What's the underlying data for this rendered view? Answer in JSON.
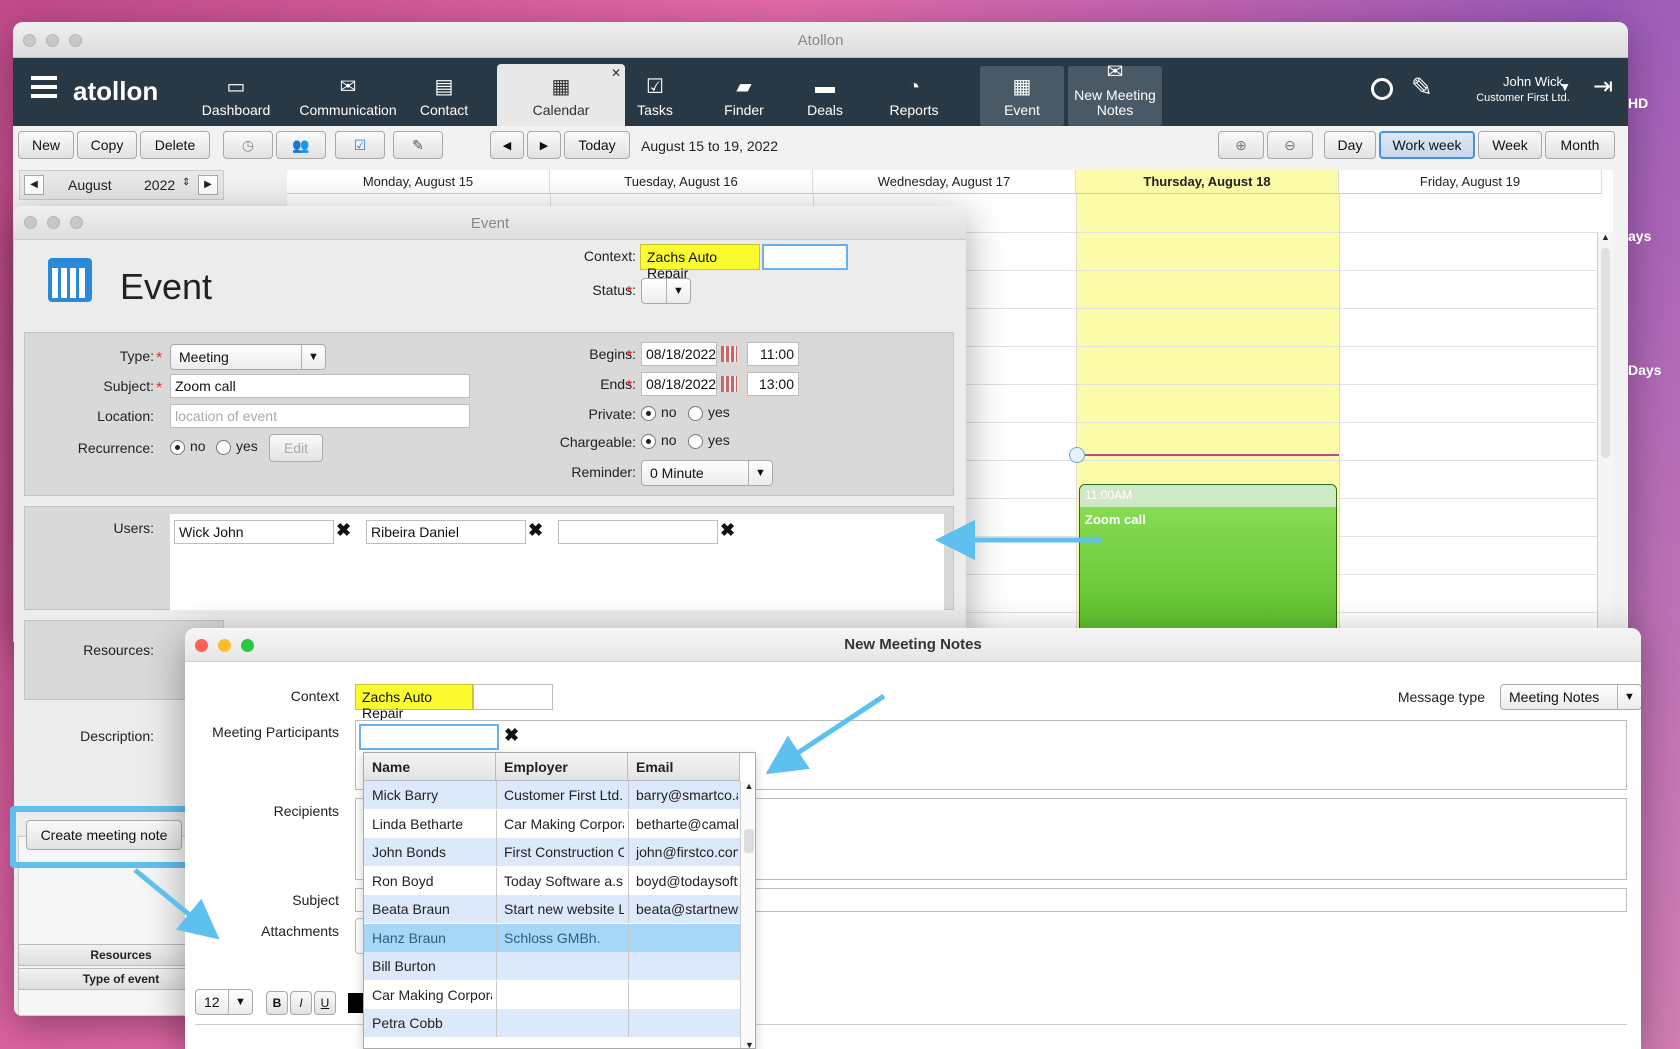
{
  "colors": {
    "accent": "#5ec0ef",
    "toolbar": "#283845",
    "today_highlight": "#fbfba8",
    "event_green": "#6fd13f",
    "context_yellow": "#fbfb2f"
  },
  "main_window": {
    "title": "Atollon",
    "logo": "atollon",
    "nav": [
      {
        "label": "Dashboard",
        "icon": "dashboard-icon",
        "glyph": "▭"
      },
      {
        "label": "Communication",
        "icon": "envelope-icon",
        "glyph": "✉"
      },
      {
        "label": "Contact",
        "icon": "contact-icon",
        "glyph": "▤"
      },
      {
        "label": "Calendar",
        "icon": "calendar-icon",
        "glyph": "▦"
      },
      {
        "label": "Tasks",
        "icon": "tasks-icon",
        "glyph": "☑"
      },
      {
        "label": "Finder",
        "icon": "finder-icon",
        "glyph": "▰"
      },
      {
        "label": "Deals",
        "icon": "deals-icon",
        "glyph": "▬"
      },
      {
        "label": "Reports",
        "icon": "reports-icon",
        "glyph": "◔"
      },
      {
        "label": "Event",
        "icon": "event-icon",
        "glyph": "▦"
      },
      {
        "label": "New Meeting Notes",
        "icon": "meeting-notes-icon",
        "glyph": "✉"
      }
    ],
    "user": {
      "name": "John Wick",
      "company": "Customer First Ltd."
    },
    "toolbar": {
      "new": "New",
      "copy": "Copy",
      "delete": "Delete",
      "today": "Today",
      "range": "August 15 to 19, 2022",
      "day": "Day",
      "work_week": "Work week",
      "week": "Week",
      "month": "Month"
    },
    "mini_cal": {
      "month": "August",
      "year": "2022"
    },
    "days": [
      "Monday, August 15",
      "Tuesday, August 16",
      "Wednesday, August 17",
      "Thursday, August 18",
      "Friday, August 19"
    ],
    "event_block": {
      "time": "11:00AM",
      "title": "Zoom call"
    },
    "edge_labels": [
      "HD",
      "ays",
      "Days"
    ]
  },
  "event_window": {
    "title": "Event",
    "heading": "Event",
    "context_label": "Context:",
    "context_value": "Zachs Auto Repair",
    "status_label": "Status:",
    "type_label": "Type:",
    "type_value": "Meeting",
    "subject_label": "Subject:",
    "subject_value": "Zoom call",
    "location_label": "Location:",
    "location_placeholder": "location of event",
    "recurrence_label": "Recurrence:",
    "no": "no",
    "yes": "yes",
    "edit": "Edit",
    "begins_label": "Begins:",
    "begins_date": "08/18/2022",
    "begins_time": "11:00",
    "ends_label": "Ends:",
    "ends_date": "08/18/2022",
    "ends_time": "13:00",
    "private_label": "Private:",
    "chargeable_label": "Chargeable:",
    "reminder_label": "Reminder:",
    "reminder_value": "0 Minute",
    "users_label": "Users:",
    "users": [
      "Wick  John",
      "Ribeira  Daniel",
      ""
    ],
    "resources_label": "Resources:",
    "description_label": "Description:",
    "create_note": "Create meeting note",
    "side_tabs": [
      "Resources",
      "Type of event"
    ]
  },
  "notes_window": {
    "title": "New Meeting Notes",
    "context_label": "Context",
    "context_value": "Zachs Auto Repair",
    "message_type_label": "Message type",
    "message_type_value": "Meeting Notes",
    "participants_label": "Meeting Participants",
    "recipients_label": "Recipients",
    "subject_label": "Subject",
    "attachments_label": "Attachments",
    "font_size": "12",
    "format": {
      "bold": "B",
      "italic": "I",
      "underline": "U"
    },
    "columns": [
      "Name",
      "Employer",
      "Email"
    ],
    "rows": [
      {
        "name": "Mick Barry",
        "employer": "Customer First Ltd.",
        "email": "barry@smartco.atollo"
      },
      {
        "name": "Linda Betharte",
        "employer": "Car Making Corpora",
        "email": "betharte@camaking"
      },
      {
        "name": "John Bonds",
        "employer": "First Construction Co",
        "email": "john@firstco.com"
      },
      {
        "name": "Ron Boyd",
        "employer": "Today Software a.s.",
        "email": "boyd@todaysoftware"
      },
      {
        "name": "Beata Braun",
        "employer": "Start new website Li",
        "email": "beata@startnewweb"
      },
      {
        "name": "Hanz Braun",
        "employer": "Schloss GMBh.",
        "email": ""
      },
      {
        "name": "Bill Burton",
        "employer": "",
        "email": ""
      },
      {
        "name": "Car Making Corpora",
        "employer": "",
        "email": ""
      },
      {
        "name": "Petra Cobb",
        "employer": "",
        "email": ""
      }
    ]
  }
}
